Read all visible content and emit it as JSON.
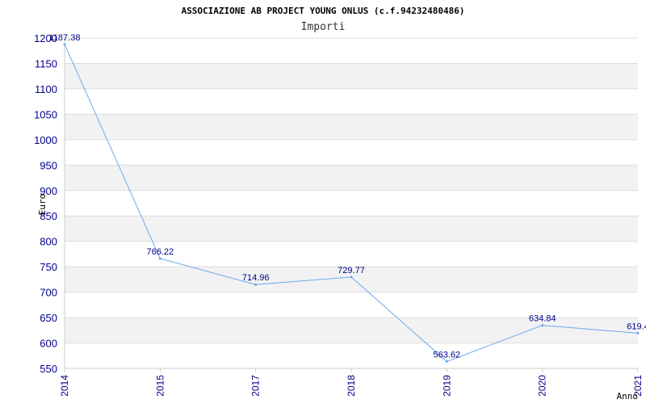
{
  "chart_data": {
    "type": "line",
    "title": "ASSOCIAZIONE AB PROJECT YOUNG ONLUS (c.f.94232480486)",
    "subtitle": "Importi",
    "xlabel": "Anno",
    "ylabel": "Euro",
    "categories": [
      "2014",
      "2015",
      "2017",
      "2018",
      "2019",
      "2020",
      "2021"
    ],
    "series": [
      {
        "values": [
          1187.38,
          766.22,
          714.96,
          729.77,
          563.62,
          634.84,
          619.4
        ],
        "labels": [
          "1187.38",
          "766.22",
          "714.96",
          "729.77",
          "563.62",
          "634.84",
          "619.4"
        ]
      }
    ],
    "ylim": [
      550,
      1200
    ],
    "yticks": [
      "550",
      "600",
      "650",
      "700",
      "750",
      "800",
      "850",
      "900",
      "950",
      "1000",
      "1050",
      "1100",
      "1150",
      "1200"
    ],
    "grid": true,
    "colors": {
      "line": "#6aa9ef",
      "band": "#f2f2f2",
      "gridline": "#dddddd",
      "text": "#00008b"
    }
  }
}
